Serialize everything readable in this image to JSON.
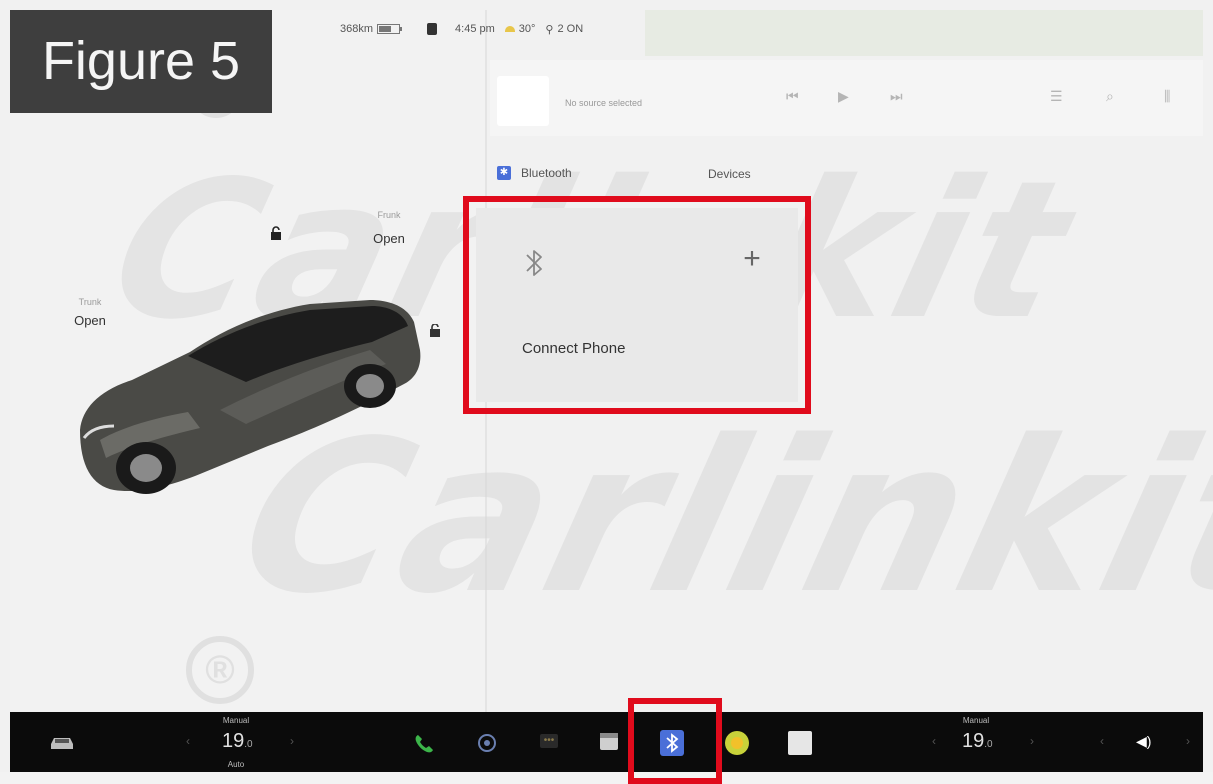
{
  "figure_label": "Figure 5",
  "watermark": {
    "text": "Carlinkit",
    "registered_mark": "®"
  },
  "status_bar": {
    "range": "368km",
    "time": "4:45 pm",
    "temperature": "30°",
    "passenger_airbag": "2 ON"
  },
  "car_panel": {
    "doors": [
      {
        "label": "Trunk",
        "state": "Open"
      },
      {
        "label": "Frunk",
        "state": "Open"
      }
    ]
  },
  "media": {
    "placeholder": "No source selected"
  },
  "bluetooth": {
    "tab_label": "Bluetooth",
    "devices_label": "Devices",
    "badge_glyph": "✱",
    "add_glyph": "+",
    "connect_text": "Connect Phone"
  },
  "bottom_bar": {
    "left_temp": {
      "mode": "Manual",
      "value": "19",
      "decimal": ".0",
      "sub": "Auto"
    },
    "right_temp": {
      "mode": "Manual",
      "value": "19",
      "decimal": ".0"
    },
    "volume_glyph": "◀)"
  },
  "colors": {
    "highlight": "#e00b1c",
    "bottom_bar": "#0b0b0b",
    "bluetooth_blue": "#4a6fd8",
    "phone_green": "#3cb54a"
  }
}
